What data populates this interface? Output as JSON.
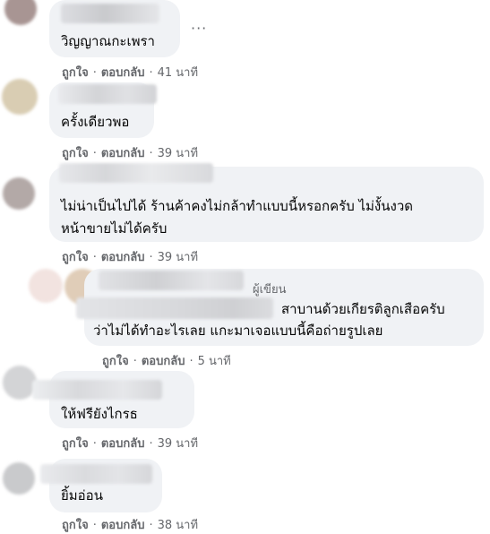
{
  "actions": {
    "like": "ถูกใจ",
    "reply": "ตอบกลับ",
    "sep": "·"
  },
  "more_icon": "more-dots-icon",
  "comments": [
    {
      "text": "วิญญาณกะเพรา",
      "time": "41 นาที"
    },
    {
      "text": "ครั้งเดียวพอ",
      "time": "39 นาที"
    },
    {
      "text_lines": [
        "ไม่น่าเป็นไปได้ ร้านค้าคงไม่กล้าทำแบบนี้หรอกครับ ไม่งั้นงวด",
        "หน้าขายไม่ได้ครับ"
      ],
      "time": "39 นาที"
    },
    {
      "badge": "ผู้เขียน",
      "text_lines": [
        "สาบานด้วยเกียรติลูกเสือครับ",
        "ว่าไม่ได้ทำอะไรเลย แกะมาเจอแบบนี้คือถ่ายรูปเลย"
      ],
      "time": "5 นาที"
    },
    {
      "text": "ให้ฟรียังไกรธ",
      "time": "39 นาที"
    },
    {
      "text": "ยิ้มอ่อน",
      "time": "38 นาที"
    }
  ]
}
